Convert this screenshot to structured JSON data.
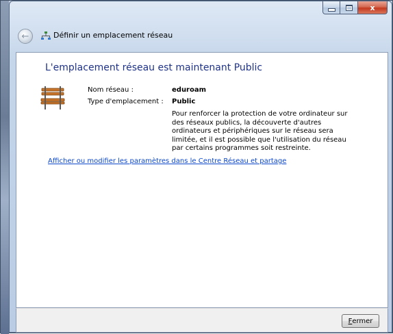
{
  "window": {
    "title": "Définir un emplacement réseau",
    "caption": {
      "minimize_icon": "minimize-icon",
      "maximize_icon": "maximize-icon",
      "close_glyph": "x"
    }
  },
  "main": {
    "heading": "L'emplacement réseau est maintenant Public",
    "network_name_label": "Nom réseau :",
    "network_name_value": "eduroam",
    "location_type_label": "Type d'emplacement :",
    "location_type_value": "Public",
    "description": "Pour renforcer la protection de votre ordinateur sur des réseaux publics, la découverte d'autres ordinateurs et périphériques sur le réseau sera limitée, et il est possible que l'utilisation du réseau par certains programmes soit restreinte.",
    "link_text": "Afficher ou modifier les paramètres dans le Centre Réseau et partage"
  },
  "footer": {
    "close_button_accel": "F",
    "close_button_rest": "ermer"
  },
  "colors": {
    "heading": "#1e3287",
    "link": "#0b47c8",
    "close_red": "#c4391f"
  }
}
